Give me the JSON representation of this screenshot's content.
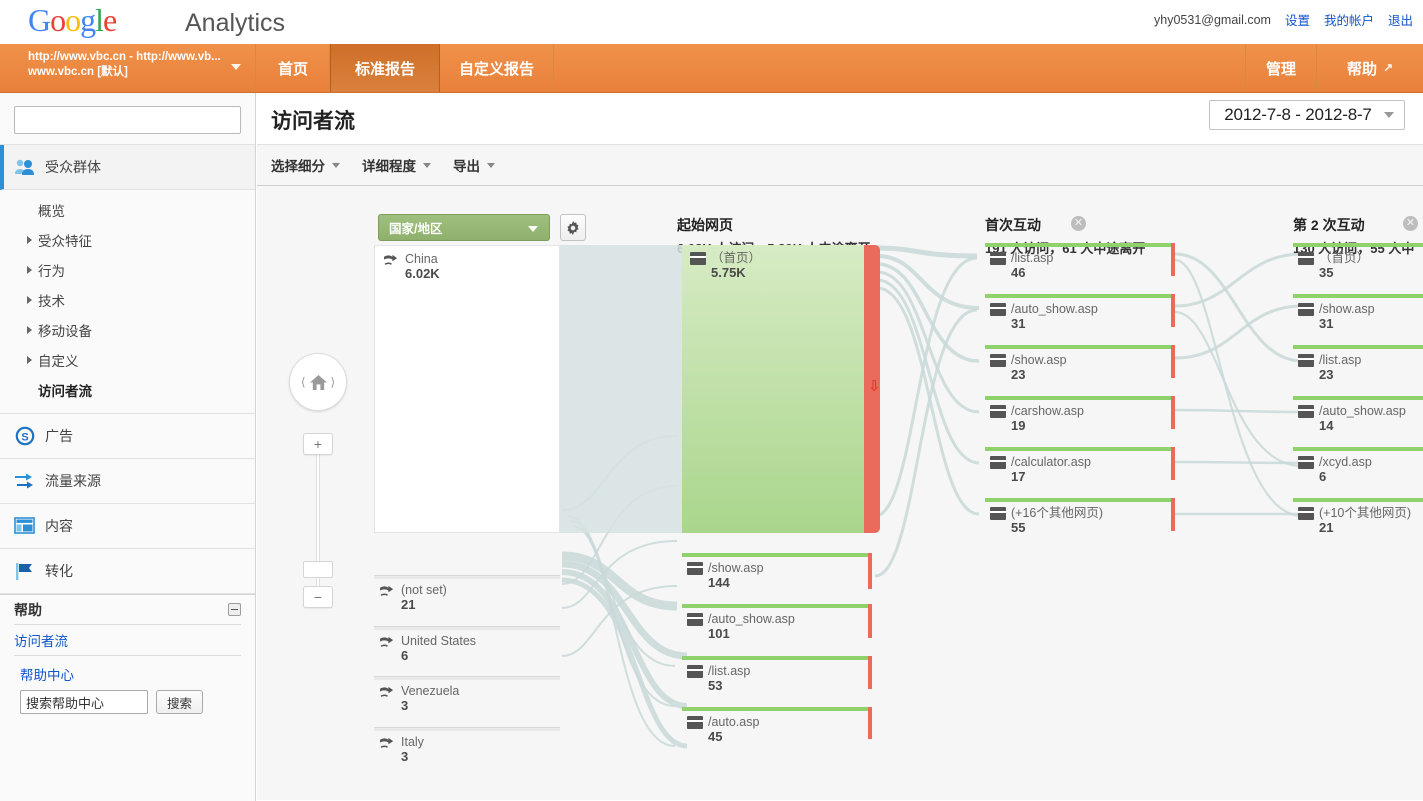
{
  "brand": {
    "logo_word": "Google",
    "product": "Analytics"
  },
  "account": {
    "email": "yhy0531@gmail.com",
    "settings": "设置",
    "my_account": "我的帐户",
    "sign_out": "退出"
  },
  "nav": {
    "profile_line1": "http://www.vbc.cn - http://www.vb...",
    "profile_line2": "www.vbc.cn [默认]",
    "tabs": [
      {
        "label": "首页",
        "active": false
      },
      {
        "label": "标准报告",
        "active": true
      },
      {
        "label": "自定义报告",
        "active": false
      }
    ],
    "admin": "管理",
    "help": "帮助"
  },
  "sidebar": {
    "search_placeholder": "",
    "sections": [
      {
        "label": "受众群体",
        "icon": "audience-icon",
        "active": true
      },
      {
        "label": "广告",
        "icon": "ads-icon",
        "active": false
      },
      {
        "label": "流量来源",
        "icon": "traffic-icon",
        "active": false
      },
      {
        "label": "内容",
        "icon": "content-icon",
        "active": false
      },
      {
        "label": "转化",
        "icon": "conversions-icon",
        "active": false
      }
    ],
    "sub_items": [
      {
        "label": "概览",
        "expandable": false,
        "selected": false
      },
      {
        "label": "受众特征",
        "expandable": true,
        "selected": false
      },
      {
        "label": "行为",
        "expandable": true,
        "selected": false
      },
      {
        "label": "技术",
        "expandable": true,
        "selected": false
      },
      {
        "label": "移动设备",
        "expandable": true,
        "selected": false
      },
      {
        "label": "自定义",
        "expandable": true,
        "selected": false
      },
      {
        "label": "访问者流",
        "expandable": false,
        "selected": true
      }
    ],
    "help": {
      "title": "帮助",
      "link": "访问者流",
      "center": "帮助中心",
      "search_value": "搜索帮助中心",
      "search_button": "搜索"
    }
  },
  "page": {
    "title": "访问者流",
    "date_range": "2012-7-8 - 2012-8-7",
    "toolbar": [
      {
        "label": "选择细分"
      },
      {
        "label": "详细程度"
      },
      {
        "label": "导出"
      }
    ]
  },
  "flow": {
    "dimension_selector": "国家/地区",
    "colors": {
      "node_green": "#8fd16a",
      "exit_red": "#ea6a5c",
      "link_grey": "#c5d5d5",
      "block_green": "#a9d68c",
      "dimension_green": "#8fb06d"
    },
    "columns": [
      {
        "id": "dimension",
        "title": "",
        "subtitle": "",
        "closable": false,
        "nodes": [
          {
            "label": "China",
            "value": "6.02K",
            "icon": "country-icon"
          },
          {
            "label": "(not set)",
            "value": "21",
            "icon": "country-icon"
          },
          {
            "label": "United States",
            "value": "6",
            "icon": "country-icon"
          },
          {
            "label": "Venezuela",
            "value": "3",
            "icon": "country-icon"
          },
          {
            "label": "Italy",
            "value": "3",
            "icon": "country-icon"
          }
        ]
      },
      {
        "id": "starting-pages",
        "title": "起始网页",
        "subtitle": "6.08K 人访问，5.89K 人中途离开",
        "closable": false,
        "nodes": [
          {
            "label": "（首页）",
            "value": "5.75K",
            "icon": "page-icon"
          },
          {
            "label": "/show.asp",
            "value": "144",
            "icon": "page-icon"
          },
          {
            "label": "/auto_show.asp",
            "value": "101",
            "icon": "page-icon"
          },
          {
            "label": "/list.asp",
            "value": "53",
            "icon": "page-icon"
          },
          {
            "label": "/auto.asp",
            "value": "45",
            "icon": "page-icon"
          }
        ]
      },
      {
        "id": "first-interaction",
        "title": "首次互动",
        "subtitle": "191 人访问，61 人中途离开",
        "closable": true,
        "nodes": [
          {
            "label": "/list.asp",
            "value": "46",
            "icon": "page-icon"
          },
          {
            "label": "/auto_show.asp",
            "value": "31",
            "icon": "page-icon"
          },
          {
            "label": "/show.asp",
            "value": "23",
            "icon": "page-icon"
          },
          {
            "label": "/carshow.asp",
            "value": "19",
            "icon": "page-icon"
          },
          {
            "label": "/calculator.asp",
            "value": "17",
            "icon": "page-icon"
          },
          {
            "label": "(+16个其他网页)",
            "value": "55",
            "icon": "page-icon"
          }
        ]
      },
      {
        "id": "second-interaction",
        "title": "第 2 次互动",
        "subtitle": "130 人访问，55 人中",
        "closable": true,
        "nodes": [
          {
            "label": "（首页）",
            "value": "35",
            "icon": "page-icon"
          },
          {
            "label": "/show.asp",
            "value": "31",
            "icon": "page-icon"
          },
          {
            "label": "/list.asp",
            "value": "23",
            "icon": "page-icon"
          },
          {
            "label": "/auto_show.asp",
            "value": "14",
            "icon": "page-icon"
          },
          {
            "label": "/xcyd.asp",
            "value": "6",
            "icon": "page-icon"
          },
          {
            "label": "(+10个其他网页)",
            "value": "21",
            "icon": "page-icon"
          }
        ]
      }
    ],
    "controls": {
      "home": "⌂",
      "zoom_in": "+",
      "zoom_out": "−"
    }
  }
}
